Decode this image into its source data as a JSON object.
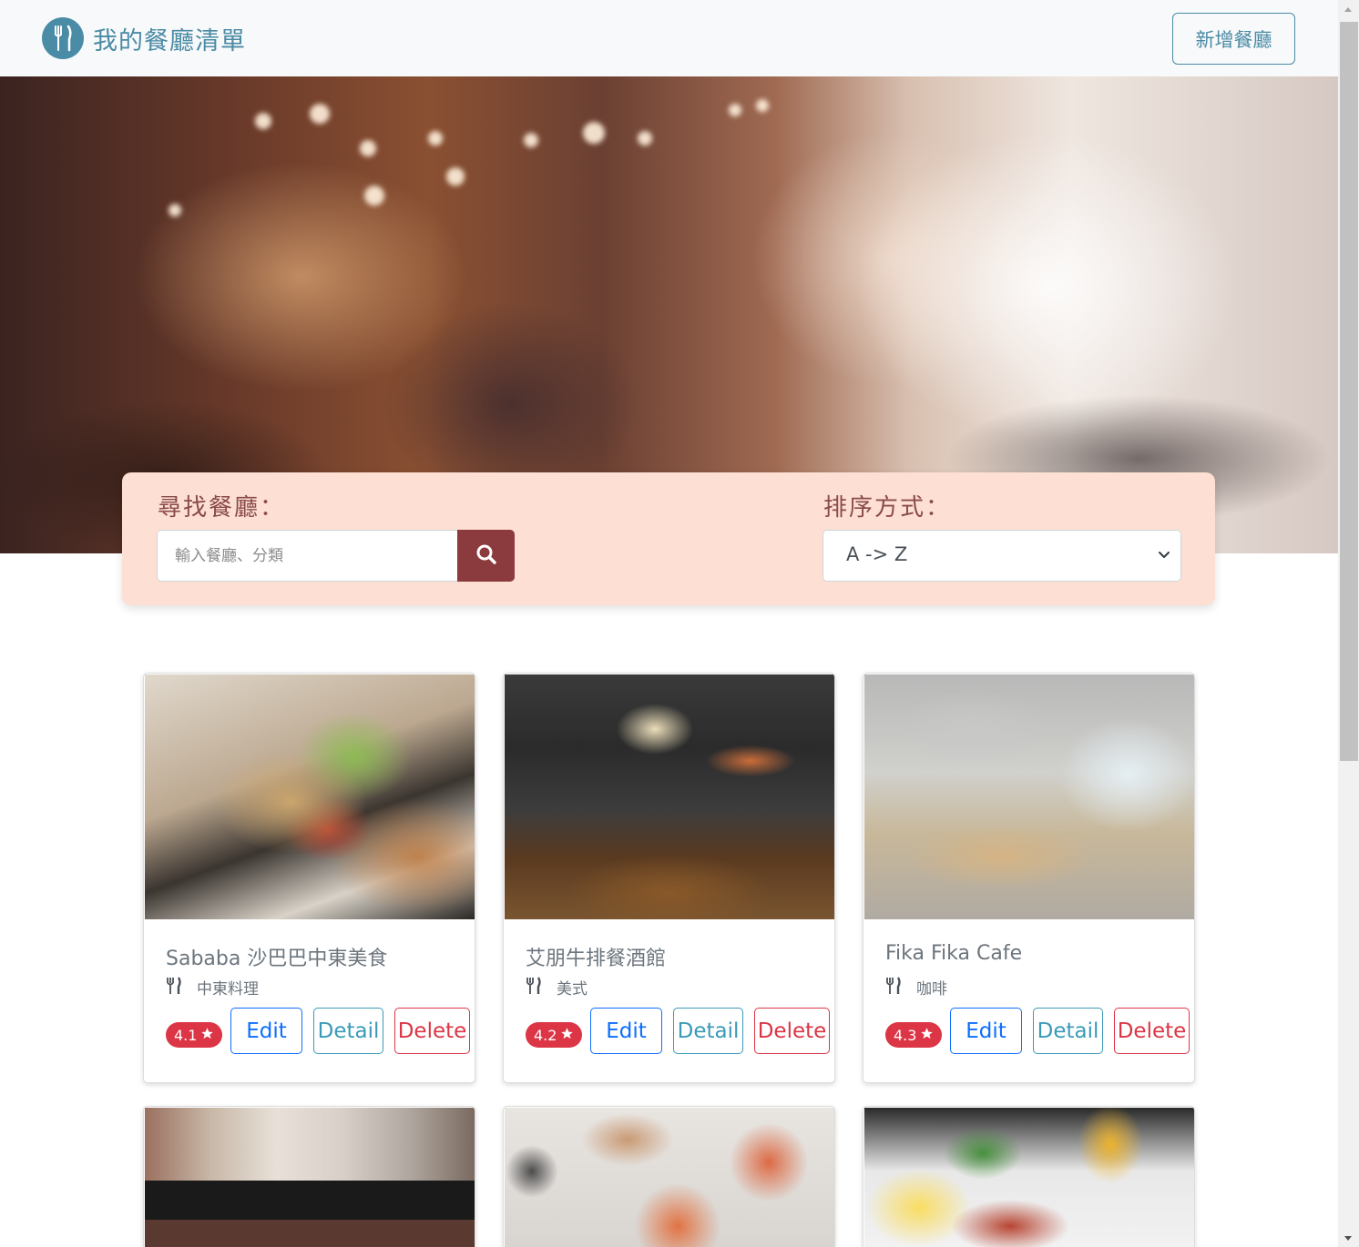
{
  "navbar": {
    "brand_text": "我的餐廳清單",
    "new_button_label": "新增餐廳",
    "brand_color": "#4a8ba5"
  },
  "search": {
    "label": "尋找餐廳：",
    "placeholder": "輸入餐廳、分類",
    "button_icon": "search-icon",
    "button_color": "#8b3a3e"
  },
  "sort": {
    "label": "排序方式：",
    "selected": "A -> Z"
  },
  "restaurants": [
    {
      "name": "Sababa 沙巴巴中東美食",
      "category": "中東料理",
      "rating": "4.1",
      "image": "pita-sandwich-photo"
    },
    {
      "name": "艾朋牛排餐酒館",
      "category": "美式",
      "rating": "4.2",
      "image": "dining-room-photo"
    },
    {
      "name": "Fika Fika Cafe",
      "category": "咖啡",
      "rating": "4.3",
      "image": "cafe-interior-photo"
    },
    {
      "image": "storefront-photo"
    },
    {
      "image": "pizza-table-photo"
    },
    {
      "image": "brunch-plate-photo"
    }
  ],
  "card_buttons": {
    "edit": "Edit",
    "detail": "Detail",
    "delete": "Delete"
  },
  "colors": {
    "panel": "#fde0d3",
    "rating_badge": "#dc3545",
    "edit": "#0d6efd",
    "detail": "#3a9ab8",
    "delete": "#dc3545"
  }
}
